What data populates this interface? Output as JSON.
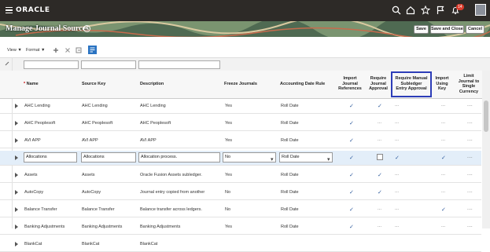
{
  "header": {
    "logo": "ORACLE",
    "notification_count": "14"
  },
  "page": {
    "title": "Manage Journal Sources"
  },
  "buttons": {
    "save": "Save",
    "save_close": "Save and Close",
    "cancel": "Cancel"
  },
  "toolbar": {
    "view": "View ▼",
    "format": "Format ▼"
  },
  "columns": {
    "name": "Name",
    "source_key": "Source Key",
    "description": "Description",
    "freeze": "Freeze Journals",
    "acct_rule": "Accounting Date Rule",
    "import_refs": [
      "Import",
      "Journal",
      "References"
    ],
    "req_approval": [
      "Require",
      "Journal",
      "Approval"
    ],
    "req_manual": [
      "Require Manual",
      "Subledger",
      "Entry Approval"
    ],
    "import_key": [
      "Import",
      "Using",
      "Key"
    ],
    "limit": [
      "Limit",
      "Journal to",
      "Single",
      "Currency"
    ]
  },
  "rows": [
    {
      "name": "AHC Lending",
      "key": "AHC Lending",
      "desc": "AHC Lending",
      "freeze": "Yes",
      "rule": "Roll Date",
      "imp": "✓",
      "appr": "✓",
      "manual": "...",
      "ikey": "...",
      "limit": "...."
    },
    {
      "name": "AHC Peoplesoft",
      "key": "AHC Peoplesoft",
      "desc": "AHC Peoplesoft",
      "freeze": "Yes",
      "rule": "Roll Date",
      "imp": "✓",
      "appr": "...",
      "manual": "...",
      "ikey": "...",
      "limit": "...."
    },
    {
      "name": "AVI APP",
      "key": "AVI APP",
      "desc": "AVI APP",
      "freeze": "Yes",
      "rule": "Roll Date",
      "imp": "✓",
      "appr": "...",
      "manual": "...",
      "ikey": "...",
      "limit": "...."
    },
    {
      "name": "Allocations",
      "key": "Allocations",
      "desc": "Allocation process.",
      "freeze": "No",
      "rule": "Roll Date",
      "imp": "✓",
      "appr": "",
      "manual": "✓",
      "ikey": "✓",
      "limit": "...."
    },
    {
      "name": "Assets",
      "key": "Assets",
      "desc": "Oracle Fusion Assets subledger.",
      "freeze": "Yes",
      "rule": "Roll Date",
      "imp": "✓",
      "appr": "✓",
      "manual": "...",
      "ikey": "...",
      "limit": "...."
    },
    {
      "name": "AutoCopy",
      "key": "AutoCopy",
      "desc": "Journal entry copied from another",
      "freeze": "No",
      "rule": "Roll Date",
      "imp": "✓",
      "appr": "✓",
      "manual": "...",
      "ikey": "...",
      "limit": "...."
    },
    {
      "name": "Balance Transfer",
      "key": "Balance Transfer",
      "desc": "Balance transfer across ledgers.",
      "freeze": "No",
      "rule": "Roll Date",
      "imp": "✓",
      "appr": "...",
      "manual": "...",
      "ikey": "✓",
      "limit": "...."
    },
    {
      "name": "Banking Adjustments",
      "key": "Banking Adjustments",
      "desc": "Banking Adjustments",
      "freeze": "Yes",
      "rule": "Roll Date",
      "imp": "✓",
      "appr": "...",
      "manual": "...",
      "ikey": "...",
      "limit": "...."
    },
    {
      "name": "BlankCat",
      "key": "BlankCat",
      "desc": "BlankCat",
      "freeze": "",
      "rule": "",
      "imp": "",
      "appr": "",
      "manual": "",
      "ikey": "",
      "limit": ""
    }
  ],
  "colors": {
    "topbar": "#2d2a27",
    "selected_row": "#e3eef9",
    "highlight_box": "#2d3db8",
    "check": "#2e5a9c"
  }
}
